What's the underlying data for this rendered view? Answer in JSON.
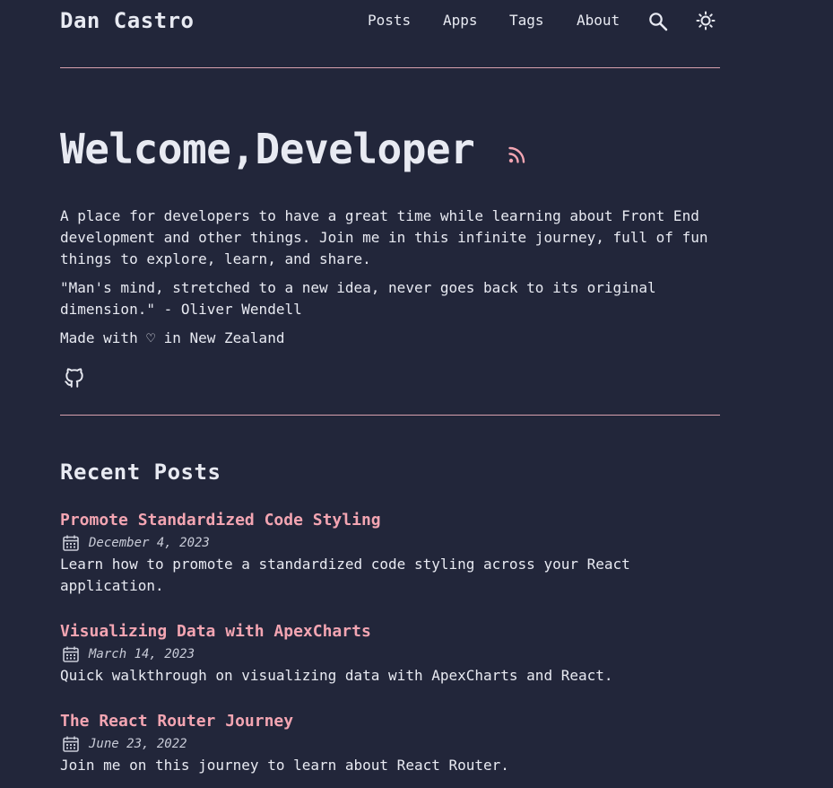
{
  "header": {
    "site_title": "Dan Castro",
    "nav": [
      {
        "label": "Posts"
      },
      {
        "label": "Apps"
      },
      {
        "label": "Tags"
      },
      {
        "label": "About"
      }
    ],
    "search_icon": "search-icon",
    "theme_icon": "sun-icon"
  },
  "hero": {
    "title": "Welcome,Developer",
    "rss_icon": "rss-icon",
    "intro": "A place for developers to have a great time while learning about Front End development and other things. Join me in this infinite journey, full of fun things to explore, learn, and share.",
    "quote": "\"Man's mind, stretched to a new idea, never goes back to its original dimension.\" - Oliver Wendell",
    "made_with": "Made with ♡ in New Zealand",
    "social_icon": "github-icon"
  },
  "recent": {
    "title": "Recent Posts",
    "posts": [
      {
        "title": "Promote Standardized Code Styling",
        "date": "December 4, 2023",
        "description": "Learn how to promote a standardized code styling across your React application."
      },
      {
        "title": "Visualizing Data with ApexCharts",
        "date": "March 14, 2023",
        "description": "Quick walkthrough on visualizing data with ApexCharts and React."
      },
      {
        "title": "The React Router Journey",
        "date": "June 23, 2022",
        "description": "Join me on this journey to learn about React Router."
      }
    ]
  },
  "colors": {
    "background": "#22263a",
    "text": "#e8eaf2",
    "accent": "#f3a5b2",
    "rule": "#d7a0ad"
  }
}
